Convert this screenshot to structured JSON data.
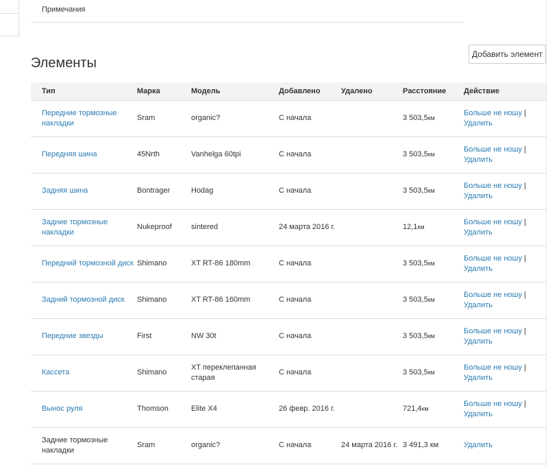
{
  "notes": {
    "label": "Примечания"
  },
  "section": {
    "title": "Элементы",
    "add_button": "Добавить элемент"
  },
  "table": {
    "headers": [
      "Тип",
      "Марка",
      "Модель",
      "Добавлено",
      "Удалено",
      "Расстояние",
      "Действие"
    ],
    "rows": [
      {
        "type": "Передние тормозные накладки",
        "type_link": true,
        "brand": "Sram",
        "model": "organic?",
        "added": "С начала",
        "removed": "",
        "distance": "3 503,5",
        "unit": "км",
        "action_main": "Больше не ношу",
        "separator": " |",
        "action_delete": "Удалить"
      },
      {
        "type": "Передняя шина",
        "type_link": true,
        "brand": "45Nrth",
        "model": "Vanhelga 60tpi",
        "added": "С начала",
        "removed": "",
        "distance": "3 503,5",
        "unit": "км",
        "action_main": "Больше не ношу",
        "separator": " |",
        "action_delete": "Удалить"
      },
      {
        "type": "Задняя шина",
        "type_link": true,
        "brand": "Bontrager",
        "model": "Hodag",
        "added": "С начала",
        "removed": "",
        "distance": "3 503,5",
        "unit": "км",
        "action_main": "Больше не ношу",
        "separator": " |",
        "action_delete": "Удалить"
      },
      {
        "type": "Задние тормозные накладки",
        "type_link": true,
        "brand": "Nukeproof",
        "model": "sintered",
        "added": "24 марта 2016 г.",
        "removed": "",
        "distance": "12,1",
        "unit": "км",
        "action_main": "Больше не ношу",
        "separator": " |",
        "action_delete": "Удалить"
      },
      {
        "type": "Передний тормозной диск",
        "type_link": true,
        "brand": "Shimano",
        "model": "XT RT-86 180mm",
        "added": "С начала",
        "removed": "",
        "distance": "3 503,5",
        "unit": "км",
        "action_main": "Больше не ношу",
        "separator": " |",
        "action_delete": "Удалить"
      },
      {
        "type": "Задний тормозной диск",
        "type_link": true,
        "brand": "Shimano",
        "model": "XT RT-86 160mm",
        "added": "С начала",
        "removed": "",
        "distance": "3 503,5",
        "unit": "км",
        "action_main": "Больше не ношу",
        "separator": " |",
        "action_delete": "Удалить"
      },
      {
        "type": "Передние звезды",
        "type_link": true,
        "brand": "First",
        "model": "NW 30t",
        "added": "С начала",
        "removed": "",
        "distance": "3 503,5",
        "unit": "км",
        "action_main": "Больше не ношу",
        "separator": " |",
        "action_delete": "Удалить"
      },
      {
        "type": "Кассета",
        "type_link": true,
        "brand": "Shimano",
        "model": "XT переклепанная старая",
        "added": "С начала",
        "removed": "",
        "distance": "3 503,5",
        "unit": "км",
        "action_main": "Больше не ношу",
        "separator": " |",
        "action_delete": "Удалить"
      },
      {
        "type": "Вынос руля",
        "type_link": true,
        "brand": "Thomson",
        "model": "Elite X4",
        "added": "26 февр. 2016 г.",
        "removed": "",
        "distance": "721,4",
        "unit": "км",
        "action_main": "Больше не ношу",
        "separator": " |",
        "action_delete": "Удалить"
      },
      {
        "type": "Задние тормозные накладки",
        "type_link": false,
        "brand": "Sram",
        "model": "organic?",
        "added": "С начала",
        "removed": "24 марта 2016 г.",
        "distance": "3 491,3 км",
        "unit": "",
        "action_main": "",
        "separator": "",
        "action_delete": "Удалить"
      }
    ]
  },
  "colors": {
    "link": "#2a7bb2",
    "border": "#dddddd",
    "header_bg": "#f3f3f3",
    "text": "#333333"
  }
}
